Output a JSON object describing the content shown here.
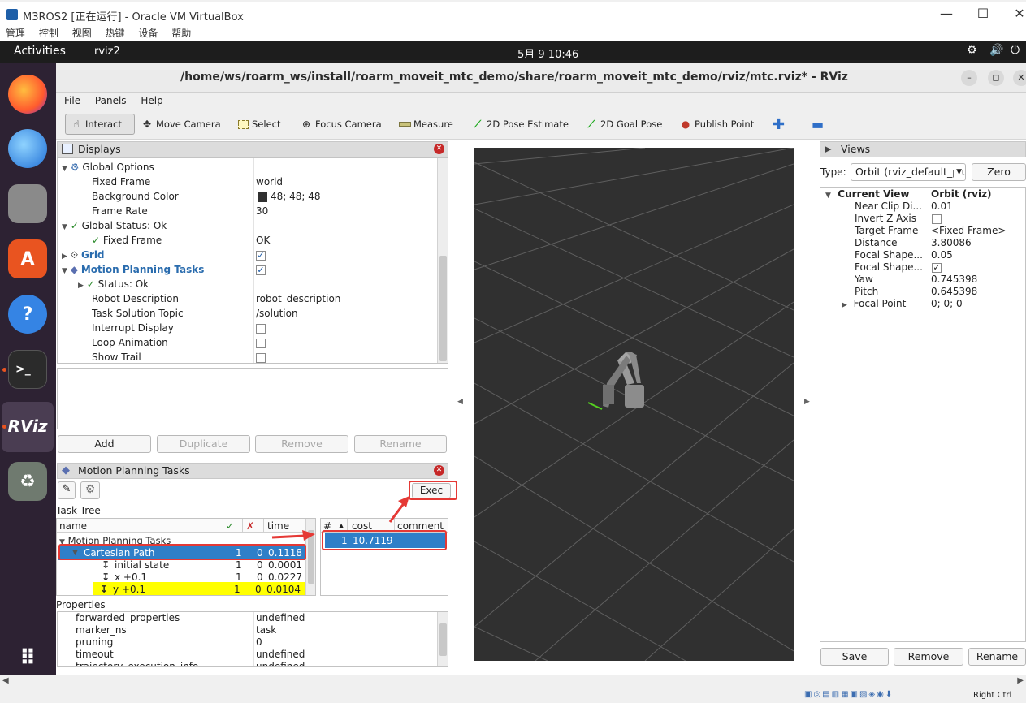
{
  "vbox": {
    "title": "M3ROS2 [正在运行] - Oracle VM VirtualBox",
    "menu": [
      "管理",
      "控制",
      "视图",
      "热键",
      "设备",
      "帮助"
    ],
    "controls": [
      "—",
      "☐",
      "✕"
    ]
  },
  "topbar": {
    "activities": "Activities",
    "app_name": "rviz2",
    "clock": "5月 9  10:46",
    "tray": [
      "⚙",
      "🔊",
      "⏻"
    ]
  },
  "dock": {
    "items": [
      "firefox",
      "thunderbird",
      "files",
      "app-center",
      "help",
      "terminal",
      "rviz",
      "trash",
      "show-apps"
    ],
    "rviz_label": "RViz"
  },
  "rviz": {
    "title": "/home/ws/roarm_ws/install/roarm_moveit_mtc_demo/share/roarm_moveit_mtc_demo/rviz/mtc.rviz* - RViz",
    "window_controls": [
      "–",
      "◻",
      "✕"
    ],
    "menu": [
      "File",
      "Panels",
      "Help"
    ],
    "tools": [
      "Interact",
      "Move Camera",
      "Select",
      "Focus Camera",
      "Measure",
      "2D Pose Estimate",
      "2D Goal Pose",
      "Publish Point"
    ]
  },
  "displays": {
    "header": "Displays",
    "rows": [
      {
        "label": "Global Options",
        "value": ""
      },
      {
        "label": "Fixed Frame",
        "value": "world"
      },
      {
        "label": "Background Color",
        "value": "48; 48; 48"
      },
      {
        "label": "Frame Rate",
        "value": "30"
      },
      {
        "label": "Global Status: Ok",
        "value": ""
      },
      {
        "label": "Fixed Frame",
        "value": "OK"
      },
      {
        "label": "Grid",
        "value": ""
      },
      {
        "label": "Motion Planning Tasks",
        "value": ""
      },
      {
        "label": "Status: Ok",
        "value": ""
      },
      {
        "label": "Robot Description",
        "value": "robot_description"
      },
      {
        "label": "Task Solution Topic",
        "value": "/solution"
      },
      {
        "label": "Interrupt Display",
        "value": ""
      },
      {
        "label": "Loop Animation",
        "value": ""
      },
      {
        "label": "Show Trail",
        "value": ""
      }
    ],
    "buttons": [
      "Add",
      "Duplicate",
      "Remove",
      "Rename"
    ]
  },
  "mpt": {
    "header": "Motion Planning Tasks",
    "exec_label": "Exec",
    "task_tree_label": "Task Tree",
    "tree_cols": [
      "name",
      "✓",
      "✗",
      "time"
    ],
    "tree_rows": [
      {
        "name": "Motion Planning Tasks",
        "ok": "",
        "fail": "",
        "time": ""
      },
      {
        "name": "Cartesian Path",
        "ok": "1",
        "fail": "0",
        "time": "0.1118"
      },
      {
        "name": "initial state",
        "ok": "1",
        "fail": "0",
        "time": "0.0001"
      },
      {
        "name": "x +0.1",
        "ok": "1",
        "fail": "0",
        "time": "0.0227"
      },
      {
        "name": "y +0.1",
        "ok": "1",
        "fail": "0",
        "time": "0.0104"
      }
    ],
    "sol_cols": [
      "#",
      "cost",
      "comment"
    ],
    "sol_rows": [
      {
        "idx": "1",
        "cost": "10.7119",
        "comment": ""
      }
    ],
    "props_label": "Properties",
    "props": [
      {
        "k": "forwarded_properties",
        "v": "undefined"
      },
      {
        "k": "marker_ns",
        "v": "task"
      },
      {
        "k": "pruning",
        "v": "0"
      },
      {
        "k": "timeout",
        "v": "undefined"
      },
      {
        "k": "trajectory_execution_info",
        "v": "undefined"
      }
    ]
  },
  "views": {
    "header": "Views",
    "type_label": "Type:",
    "type_value": "Orbit (rviz_default_plugins)",
    "zero_label": "Zero",
    "current_view": "Current View",
    "current_view_value": "Orbit (rviz)",
    "rows": [
      {
        "k": "Near Clip Di...",
        "v": "0.01"
      },
      {
        "k": "Invert Z Axis",
        "v": ""
      },
      {
        "k": "Target Frame",
        "v": "<Fixed Frame>"
      },
      {
        "k": "Distance",
        "v": "3.80086"
      },
      {
        "k": "Focal Shape...",
        "v": "0.05"
      },
      {
        "k": "Focal Shape...",
        "v": ""
      },
      {
        "k": "Yaw",
        "v": "0.745398"
      },
      {
        "k": "Pitch",
        "v": "0.645398"
      },
      {
        "k": "Focal Point",
        "v": "0; 0; 0"
      }
    ],
    "buttons": [
      "Save",
      "Remove",
      "Rename"
    ]
  },
  "statusbar": {
    "right_text": "Right Ctrl"
  },
  "colors": {
    "selection": "#2f7fc8",
    "highlight": "#ffff00",
    "annotation": "#e53935",
    "viewport_bg": "#303030"
  }
}
